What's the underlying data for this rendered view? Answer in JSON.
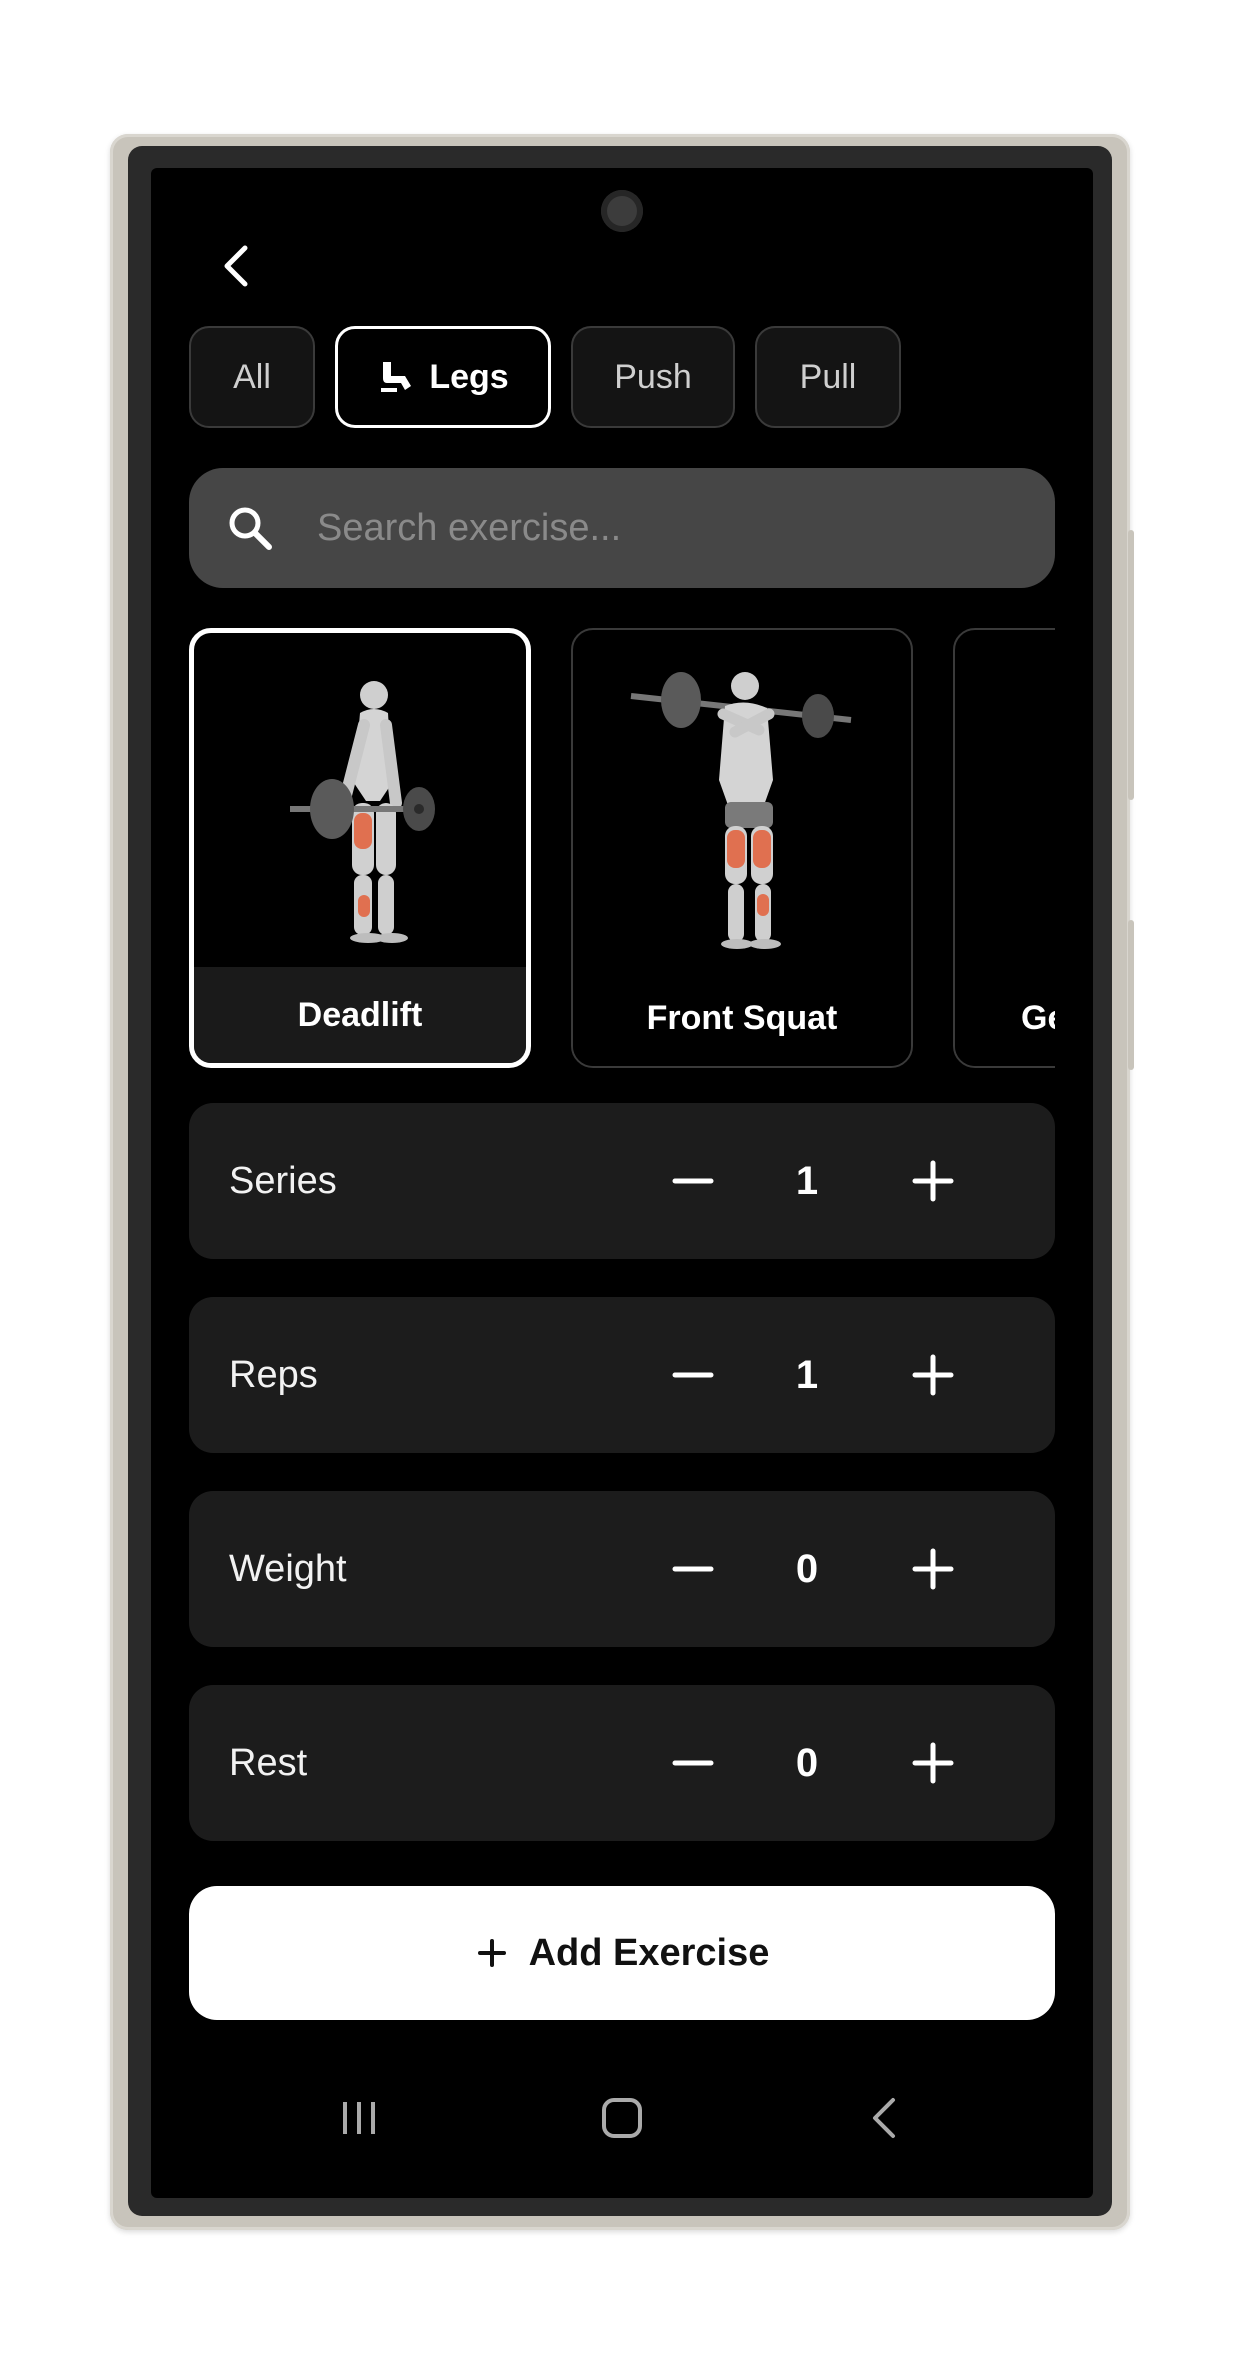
{
  "filters": [
    {
      "label": "All",
      "active": false
    },
    {
      "label": "Legs",
      "active": true,
      "icon": "leg-press-icon"
    },
    {
      "label": "Push",
      "active": false
    },
    {
      "label": "Pull",
      "active": false
    }
  ],
  "search": {
    "placeholder": "Search exercise..."
  },
  "exercises": [
    {
      "name": "Deadlift",
      "selected": true
    },
    {
      "name": "Front Squat",
      "selected": false
    },
    {
      "name": "Ge",
      "selected": false
    }
  ],
  "settings": [
    {
      "label": "Series",
      "value": "1"
    },
    {
      "label": "Reps",
      "value": "1"
    },
    {
      "label": "Weight",
      "value": "0"
    },
    {
      "label": "Rest",
      "value": "0"
    }
  ],
  "add_button": {
    "label": "Add Exercise"
  },
  "colors": {
    "background": "#000000",
    "card": "#1c1c1c",
    "search": "#464646",
    "muscle_highlight": "#e07050"
  }
}
